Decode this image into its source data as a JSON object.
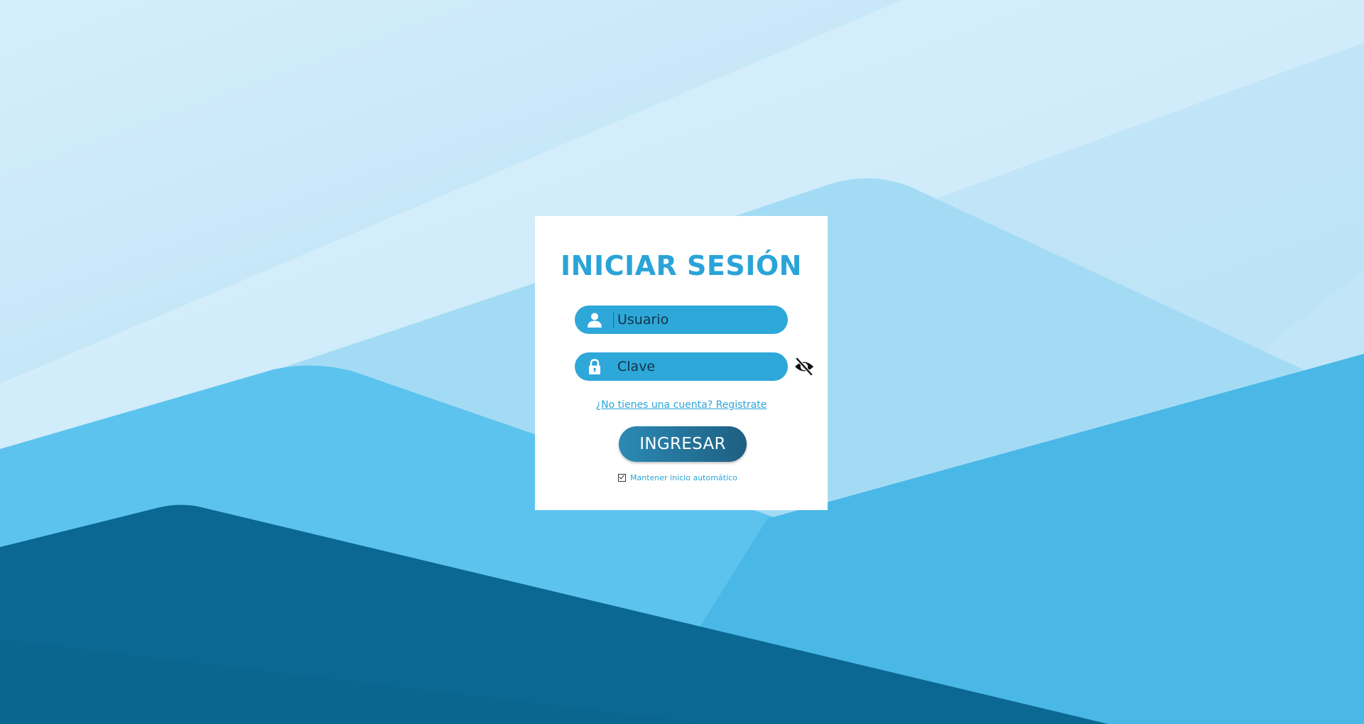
{
  "login": {
    "title": "INICIAR SESIÓN",
    "username_placeholder": "Usuario",
    "password_placeholder": "Clave",
    "register_link": "¿No tienes una cuenta? Registrate",
    "submit_label": "INGRESAR",
    "remember_label": "Mantener inicio automático",
    "remember_checked": true
  },
  "icons": {
    "user": "user-icon",
    "lock": "lock-icon",
    "password_toggle": "eye-slash-icon",
    "checkbox": "checkbox-checked-icon"
  },
  "colors": {
    "accent": "#2aa4d8",
    "field_bg": "#2ea7d9",
    "button_start": "#2b8ab4",
    "button_end": "#1e5f82",
    "card_bg": "#ffffff"
  }
}
